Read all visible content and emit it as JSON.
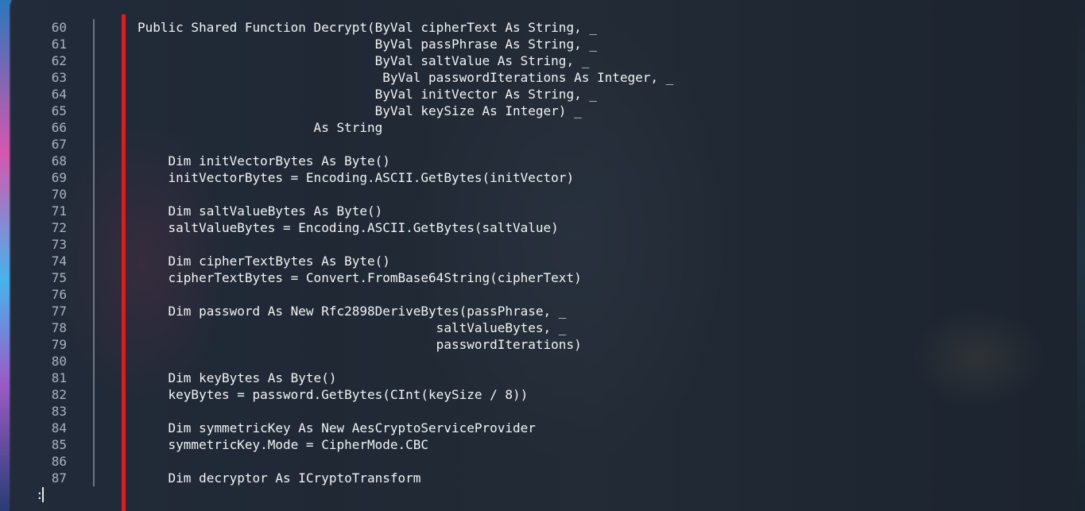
{
  "editor": {
    "lines": [
      {
        "num": "60",
        "code": "Public Shared Function Decrypt(ByVal cipherText As String, _"
      },
      {
        "num": "61",
        "code": "                               ByVal passPhrase As String, _"
      },
      {
        "num": "62",
        "code": "                               ByVal saltValue As String, _"
      },
      {
        "num": "63",
        "code": "                                ByVal passwordIterations As Integer, _"
      },
      {
        "num": "64",
        "code": "                               ByVal initVector As String, _"
      },
      {
        "num": "65",
        "code": "                               ByVal keySize As Integer) _"
      },
      {
        "num": "66",
        "code": "                       As String"
      },
      {
        "num": "67",
        "code": ""
      },
      {
        "num": "68",
        "code": "    Dim initVectorBytes As Byte()"
      },
      {
        "num": "69",
        "code": "    initVectorBytes = Encoding.ASCII.GetBytes(initVector)"
      },
      {
        "num": "70",
        "code": ""
      },
      {
        "num": "71",
        "code": "    Dim saltValueBytes As Byte()"
      },
      {
        "num": "72",
        "code": "    saltValueBytes = Encoding.ASCII.GetBytes(saltValue)"
      },
      {
        "num": "73",
        "code": ""
      },
      {
        "num": "74",
        "code": "    Dim cipherTextBytes As Byte()"
      },
      {
        "num": "75",
        "code": "    cipherTextBytes = Convert.FromBase64String(cipherText)"
      },
      {
        "num": "76",
        "code": ""
      },
      {
        "num": "77",
        "code": "    Dim password As New Rfc2898DeriveBytes(passPhrase, _"
      },
      {
        "num": "78",
        "code": "                                       saltValueBytes, _"
      },
      {
        "num": "79",
        "code": "                                       passwordIterations)"
      },
      {
        "num": "80",
        "code": ""
      },
      {
        "num": "81",
        "code": "    Dim keyBytes As Byte()"
      },
      {
        "num": "82",
        "code": "    keyBytes = password.GetBytes(CInt(keySize / 8))"
      },
      {
        "num": "83",
        "code": ""
      },
      {
        "num": "84",
        "code": "    Dim symmetricKey As New AesCryptoServiceProvider"
      },
      {
        "num": "85",
        "code": "    symmetricKey.Mode = CipherMode.CBC"
      },
      {
        "num": "86",
        "code": ""
      },
      {
        "num": "87",
        "code": "    Dim decryptor As ICryptoTransform"
      }
    ]
  },
  "prompt": {
    "text": ":"
  },
  "colors": {
    "marker_bar": "#e01b1b",
    "text": "#f2f4f6",
    "line_number": "#a9b3bd"
  }
}
